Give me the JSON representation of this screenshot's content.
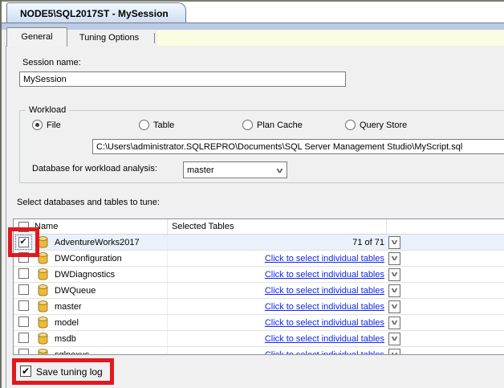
{
  "window": {
    "doc_tab_title": "NODE5\\SQL2017ST - MySession",
    "tabs": {
      "general": "General",
      "tuning_options": "Tuning Options"
    }
  },
  "session": {
    "label": "Session name:",
    "value": "MySession"
  },
  "workload": {
    "group_label": "Workload",
    "options": [
      {
        "label": "File",
        "selected": true
      },
      {
        "label": "Table",
        "selected": false
      },
      {
        "label": "Plan Cache",
        "selected": false
      },
      {
        "label": "Query Store",
        "selected": false
      }
    ],
    "file_path": "C:\\Users\\administrator.SQLREPRO\\Documents\\SQL Server Management Studio\\MyScript.sql",
    "database_label": "Database for workload analysis:",
    "database_value": "master"
  },
  "tune": {
    "label": "Select databases and tables to tune:",
    "columns": {
      "name": "Name",
      "selected_tables": "Selected Tables"
    },
    "rows": [
      {
        "name": "AdventureWorks2017",
        "checked": true,
        "highlighted": true,
        "link": false,
        "selected_tables": "71 of 71"
      },
      {
        "name": "DWConfiguration",
        "checked": false,
        "highlighted": false,
        "link": true,
        "selected_tables": "Click to select individual tables"
      },
      {
        "name": "DWDiagnostics",
        "checked": false,
        "highlighted": false,
        "link": true,
        "selected_tables": "Click to select individual tables"
      },
      {
        "name": "DWQueue",
        "checked": false,
        "highlighted": false,
        "link": true,
        "selected_tables": "Click to select individual tables"
      },
      {
        "name": "master",
        "checked": false,
        "highlighted": false,
        "link": true,
        "selected_tables": "Click to select individual tables"
      },
      {
        "name": "model",
        "checked": false,
        "highlighted": false,
        "link": true,
        "selected_tables": "Click to select individual tables"
      },
      {
        "name": "msdb",
        "checked": false,
        "highlighted": false,
        "link": true,
        "selected_tables": "Click to select individual tables"
      },
      {
        "name": "sqlnexus",
        "checked": false,
        "highlighted": false,
        "link": true,
        "selected_tables": "Click to select individual tables"
      }
    ]
  },
  "footer": {
    "save_tuning_log_label": "Save tuning log",
    "checked": true
  },
  "colors": {
    "annotation_red": "#E1191E",
    "link_blue": "#1225EE",
    "tab_band_blue": "#BACBE3",
    "yellow_band": "#FCFCE1",
    "selected_row": "#EAF1FA",
    "background": "#F0F0F0"
  }
}
